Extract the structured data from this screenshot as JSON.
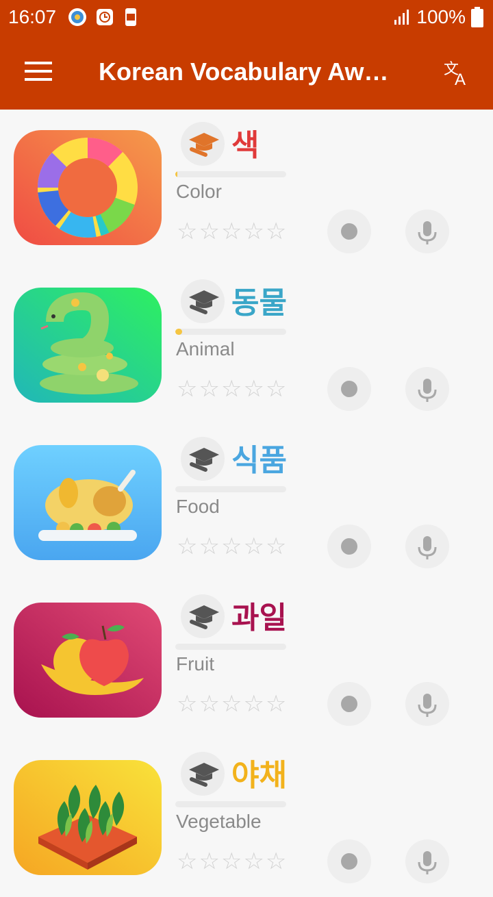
{
  "status_bar": {
    "time": "16:07",
    "battery": "100%"
  },
  "app_bar": {
    "title": "Korean Vocabulary Awesome",
    "menu_icon": "hamburger-icon",
    "action_icon": "translate-icon"
  },
  "colors": {
    "primary": "#c83c00",
    "star_empty": "#d2d2d2",
    "progress": "#f5c542"
  },
  "items": [
    {
      "word": "색",
      "meaning": "Color",
      "word_color": "#e03a3a",
      "progress": 0.02,
      "rating": 0,
      "max_rating": 5,
      "icon": "color-wheel-icon"
    },
    {
      "word": "동물",
      "meaning": "Animal",
      "word_color": "#3aa6c8",
      "progress": 0.06,
      "rating": 0,
      "max_rating": 5,
      "icon": "snake-icon"
    },
    {
      "word": "식품",
      "meaning": "Food",
      "word_color": "#4aa6e0",
      "progress": 0,
      "rating": 0,
      "max_rating": 5,
      "icon": "roast-chicken-icon"
    },
    {
      "word": "과일",
      "meaning": "Fruit",
      "word_color": "#a8124f",
      "progress": 0,
      "rating": 0,
      "max_rating": 5,
      "icon": "fruit-icon"
    },
    {
      "word": "야채",
      "meaning": "Vegetable",
      "word_color": "#f2b21c",
      "progress": 0,
      "rating": 0,
      "max_rating": 5,
      "icon": "vegetable-icon"
    }
  ]
}
